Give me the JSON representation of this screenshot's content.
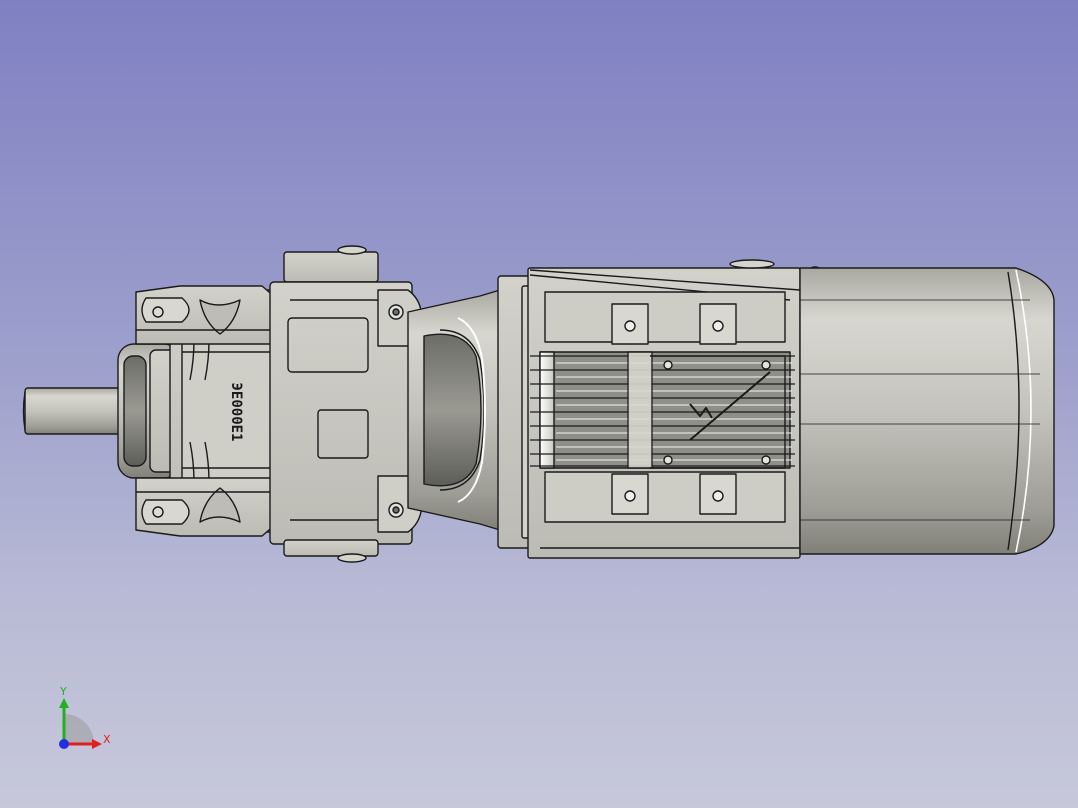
{
  "viewport": {
    "background_top": "#7f80c2",
    "background_bottom": "#c7c8da"
  },
  "model": {
    "name": "gear-motor",
    "body_color": "#c9c9c3",
    "edge_color": "#1a1a1a",
    "housing_marking": "ЭE000E1"
  },
  "axes": {
    "x_label": "X",
    "y_label": "Y",
    "x_color": "#e02020",
    "y_color": "#20b020",
    "z_color": "#2030e0"
  }
}
